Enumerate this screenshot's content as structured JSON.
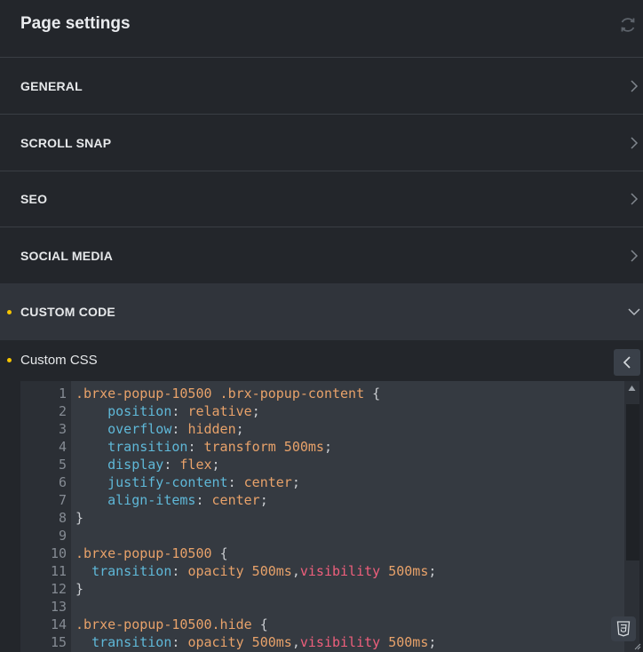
{
  "header": {
    "title": "Page settings",
    "refresh_icon": "refresh-icon"
  },
  "sections": [
    {
      "label": "GENERAL"
    },
    {
      "label": "SCROLL SNAP"
    },
    {
      "label": "SEO"
    },
    {
      "label": "SOCIAL MEDIA"
    },
    {
      "label": "CUSTOM CODE",
      "expanded": true
    }
  ],
  "custom_code": {
    "field_label": "Custom CSS",
    "lines": [
      {
        "n": "1",
        "tokens": [
          {
            "t": ".brxe-popup-10500 .brx-popup-content ",
            "c": "sel"
          },
          {
            "t": "{",
            "c": "punc"
          }
        ]
      },
      {
        "n": "2",
        "tokens": [
          {
            "t": "    ",
            "c": "punc"
          },
          {
            "t": "position",
            "c": "prop"
          },
          {
            "t": ": ",
            "c": "punc"
          },
          {
            "t": "relative",
            "c": "val"
          },
          {
            "t": ";",
            "c": "punc"
          }
        ]
      },
      {
        "n": "3",
        "tokens": [
          {
            "t": "    ",
            "c": "punc"
          },
          {
            "t": "overflow",
            "c": "prop"
          },
          {
            "t": ": ",
            "c": "punc"
          },
          {
            "t": "hidden",
            "c": "val"
          },
          {
            "t": ";",
            "c": "punc"
          }
        ]
      },
      {
        "n": "4",
        "tokens": [
          {
            "t": "    ",
            "c": "punc"
          },
          {
            "t": "transition",
            "c": "prop"
          },
          {
            "t": ": ",
            "c": "punc"
          },
          {
            "t": "transform 500ms",
            "c": "val"
          },
          {
            "t": ";",
            "c": "punc"
          }
        ]
      },
      {
        "n": "5",
        "tokens": [
          {
            "t": "    ",
            "c": "punc"
          },
          {
            "t": "display",
            "c": "prop"
          },
          {
            "t": ": ",
            "c": "punc"
          },
          {
            "t": "flex",
            "c": "val"
          },
          {
            "t": ";",
            "c": "punc"
          }
        ]
      },
      {
        "n": "6",
        "tokens": [
          {
            "t": "    ",
            "c": "punc"
          },
          {
            "t": "justify-content",
            "c": "prop"
          },
          {
            "t": ": ",
            "c": "punc"
          },
          {
            "t": "center",
            "c": "val"
          },
          {
            "t": ";",
            "c": "punc"
          }
        ]
      },
      {
        "n": "7",
        "tokens": [
          {
            "t": "    ",
            "c": "punc"
          },
          {
            "t": "align-items",
            "c": "prop"
          },
          {
            "t": ": ",
            "c": "punc"
          },
          {
            "t": "center",
            "c": "val"
          },
          {
            "t": ";",
            "c": "punc"
          }
        ]
      },
      {
        "n": "8",
        "tokens": [
          {
            "t": "}",
            "c": "punc"
          }
        ]
      },
      {
        "n": "9",
        "tokens": []
      },
      {
        "n": "10",
        "tokens": [
          {
            "t": ".brxe-popup-10500 ",
            "c": "sel"
          },
          {
            "t": "{",
            "c": "punc"
          }
        ]
      },
      {
        "n": "11",
        "tokens": [
          {
            "t": "  ",
            "c": "punc"
          },
          {
            "t": "transition",
            "c": "prop"
          },
          {
            "t": ": ",
            "c": "punc"
          },
          {
            "t": "opacity 500ms",
            "c": "val"
          },
          {
            "t": ",",
            "c": "punc"
          },
          {
            "t": "visibility",
            "c": "kw"
          },
          {
            "t": " 500ms",
            "c": "val"
          },
          {
            "t": ";",
            "c": "punc"
          }
        ]
      },
      {
        "n": "12",
        "tokens": [
          {
            "t": "}",
            "c": "punc"
          }
        ]
      },
      {
        "n": "13",
        "tokens": []
      },
      {
        "n": "14",
        "tokens": [
          {
            "t": ".brxe-popup-10500.hide ",
            "c": "sel"
          },
          {
            "t": "{",
            "c": "punc"
          }
        ]
      },
      {
        "n": "15",
        "tokens": [
          {
            "t": "  ",
            "c": "punc"
          },
          {
            "t": "transition",
            "c": "prop"
          },
          {
            "t": ": ",
            "c": "punc"
          },
          {
            "t": "opacity 500ms",
            "c": "val"
          },
          {
            "t": ",",
            "c": "punc"
          },
          {
            "t": "visibility",
            "c": "kw"
          },
          {
            "t": " 500ms",
            "c": "val"
          },
          {
            "t": ";",
            "c": "punc"
          }
        ]
      }
    ]
  },
  "colors": {
    "background": "#23262b",
    "active_section": "#30343b",
    "editor_bg": "#353a41",
    "indicator_dot": "#f5c400",
    "selector": "#e8a26a",
    "property": "#5fb8d8",
    "keyword": "#ee5f7c"
  }
}
